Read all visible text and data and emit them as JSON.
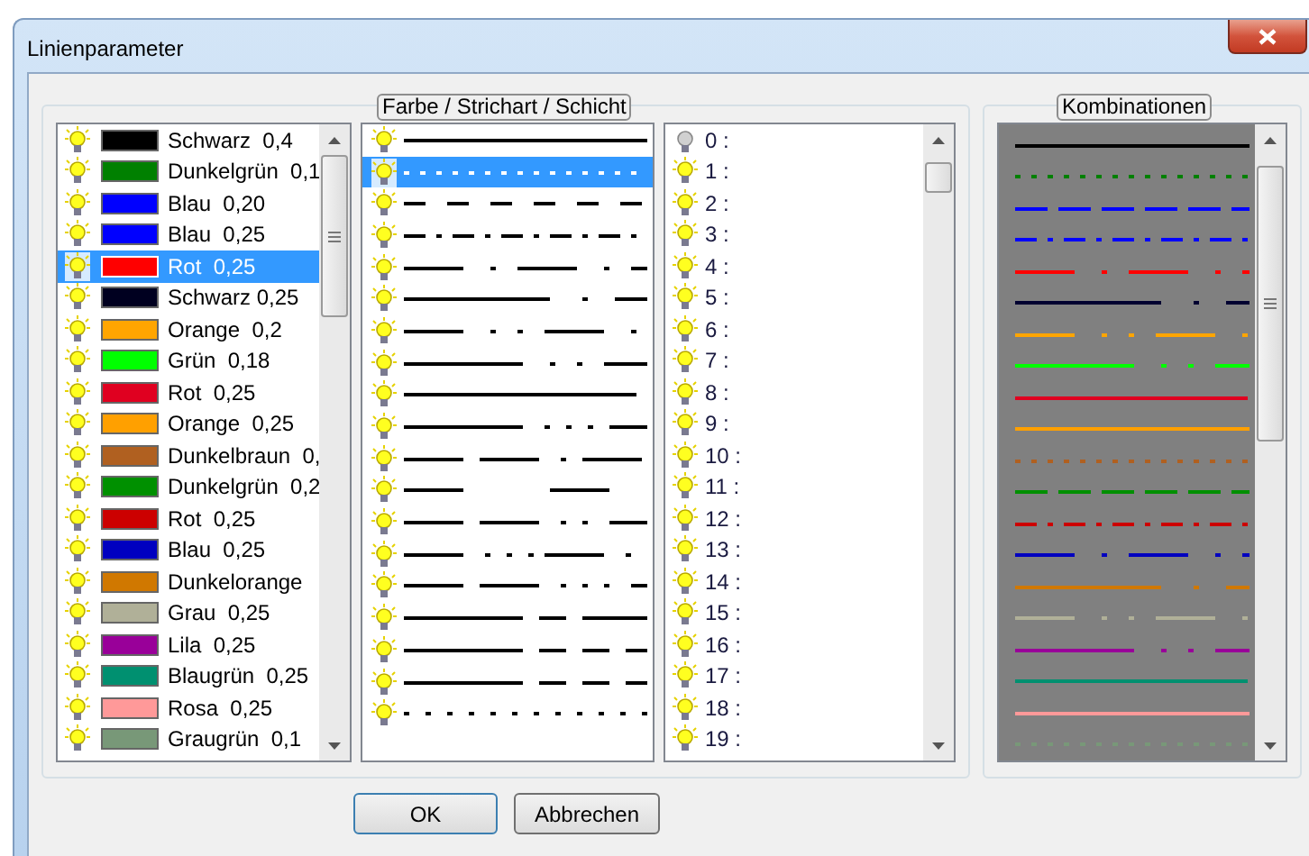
{
  "window": {
    "title": "Linienparameter"
  },
  "groups": [
    {
      "title": "Farbe / Strichart / Schicht"
    },
    {
      "title": "Kombinationen"
    }
  ],
  "colors": [
    {
      "label": "Schwarz  0,4",
      "color": "#000000",
      "lit": true,
      "selected": false
    },
    {
      "label": "Dunkelgrün  0,1",
      "color": "#008000",
      "lit": true,
      "selected": false
    },
    {
      "label": "Blau  0,20",
      "color": "#0000ff",
      "lit": true,
      "selected": false
    },
    {
      "label": "Blau  0,25",
      "color": "#0000ff",
      "lit": true,
      "selected": false
    },
    {
      "label": "Rot  0,25",
      "color": "#ff0000",
      "lit": true,
      "selected": true
    },
    {
      "label": "Schwarz 0,25",
      "color": "#000020",
      "lit": true,
      "selected": false
    },
    {
      "label": "Orange  0,2",
      "color": "#ffa500",
      "lit": true,
      "selected": false
    },
    {
      "label": "Grün  0,18",
      "color": "#00ff00",
      "lit": true,
      "selected": false
    },
    {
      "label": "Rot  0,25",
      "color": "#e00020",
      "lit": true,
      "selected": false
    },
    {
      "label": "Orange  0,25",
      "color": "#ffa000",
      "lit": true,
      "selected": false
    },
    {
      "label": "Dunkelbraun  0,",
      "color": "#b06020",
      "lit": true,
      "selected": false
    },
    {
      "label": "Dunkelgrün  0,2",
      "color": "#009000",
      "lit": true,
      "selected": false
    },
    {
      "label": "Rot  0,25",
      "color": "#cc0000",
      "lit": true,
      "selected": false
    },
    {
      "label": "Blau  0,25",
      "color": "#0000c0",
      "lit": true,
      "selected": false
    },
    {
      "label": "Dunkelorange",
      "color": "#d07800",
      "lit": true,
      "selected": false
    },
    {
      "label": "Grau  0,25",
      "color": "#b0b098",
      "lit": true,
      "selected": false
    },
    {
      "label": "Lila  0,25",
      "color": "#990099",
      "lit": true,
      "selected": false
    },
    {
      "label": "Blaugrün  0,25",
      "color": "#009070",
      "lit": true,
      "selected": false
    },
    {
      "label": "Rosa  0,25",
      "color": "#ff9999",
      "lit": true,
      "selected": false
    },
    {
      "label": "Graugrün  0,1",
      "color": "#789878",
      "lit": true,
      "selected": false
    }
  ],
  "line_styles": [
    {
      "kind": "solid",
      "lit": true,
      "selected": false
    },
    {
      "kind": "dotted",
      "lit": true,
      "selected": true
    },
    {
      "kind": "dashed",
      "lit": true,
      "selected": false
    },
    {
      "kind": "dashdot",
      "lit": true,
      "selected": false
    },
    {
      "kind": "longdashdot",
      "lit": true,
      "selected": false
    },
    {
      "kind": "verylongdashdot",
      "lit": true,
      "selected": false
    },
    {
      "kind": "longdashdotdot",
      "lit": true,
      "selected": false
    },
    {
      "kind": "verylongdashdotdot",
      "lit": true,
      "selected": false
    },
    {
      "kind": "longgap",
      "lit": true,
      "selected": false
    },
    {
      "kind": "verylongdashdotdotdot",
      "lit": true,
      "selected": false
    },
    {
      "kind": "dashdashdot",
      "lit": true,
      "selected": false
    },
    {
      "kind": "dashwidegap",
      "lit": true,
      "selected": false
    },
    {
      "kind": "dashdashdotdot",
      "lit": true,
      "selected": false
    },
    {
      "kind": "dashdotdotdot",
      "lit": true,
      "selected": false
    },
    {
      "kind": "dashdashdotdotdot",
      "lit": true,
      "selected": false
    },
    {
      "kind": "longdashshort",
      "lit": true,
      "selected": false
    },
    {
      "kind": "longdashshortshort",
      "lit": true,
      "selected": false
    },
    {
      "kind": "longdashshortshort",
      "lit": true,
      "selected": false
    },
    {
      "kind": "sparsedotted",
      "lit": true,
      "selected": false
    }
  ],
  "layers": [
    {
      "label": "0 :",
      "lit": false,
      "selected": false
    },
    {
      "label": "1 :",
      "lit": true,
      "selected": false
    },
    {
      "label": "2 :",
      "lit": true,
      "selected": false
    },
    {
      "label": "3 :",
      "lit": true,
      "selected": false
    },
    {
      "label": "4 :",
      "lit": true,
      "selected": false
    },
    {
      "label": "5 :",
      "lit": true,
      "selected": false
    },
    {
      "label": "6 :",
      "lit": true,
      "selected": false
    },
    {
      "label": "7 :",
      "lit": true,
      "selected": false
    },
    {
      "label": "8 :",
      "lit": true,
      "selected": false
    },
    {
      "label": "9 :",
      "lit": true,
      "selected": false
    },
    {
      "label": "10 :",
      "lit": true,
      "selected": false
    },
    {
      "label": "11 :",
      "lit": true,
      "selected": false
    },
    {
      "label": "12 :",
      "lit": true,
      "selected": false
    },
    {
      "label": "13 :",
      "lit": true,
      "selected": false
    },
    {
      "label": "14 :",
      "lit": true,
      "selected": false
    },
    {
      "label": "15 :",
      "lit": true,
      "selected": false
    },
    {
      "label": "16 :",
      "lit": true,
      "selected": false
    },
    {
      "label": "17 :",
      "lit": true,
      "selected": false
    },
    {
      "label": "18 :",
      "lit": true,
      "selected": false
    },
    {
      "label": "19 :",
      "lit": true,
      "selected": false
    }
  ],
  "combinations": [
    {
      "color": "#000000",
      "kind": "solid"
    },
    {
      "color": "#008000",
      "kind": "dotted"
    },
    {
      "color": "#0000ff",
      "kind": "widedashed"
    },
    {
      "color": "#0000ff",
      "kind": "dashdot"
    },
    {
      "color": "#ff0000",
      "kind": "longdashdot"
    },
    {
      "color": "#000030",
      "kind": "verylongdashdot"
    },
    {
      "color": "#ffa500",
      "kind": "longdashdotdot"
    },
    {
      "color": "#00ff00",
      "kind": "verylongdashdotdot"
    },
    {
      "color": "#e00020",
      "kind": "longgap"
    },
    {
      "color": "#ffa000",
      "kind": "solid"
    },
    {
      "color": "#b06020",
      "kind": "dotted"
    },
    {
      "color": "#009000",
      "kind": "widedashed"
    },
    {
      "color": "#cc0000",
      "kind": "dashdot"
    },
    {
      "color": "#0000c0",
      "kind": "longdashdot"
    },
    {
      "color": "#d07800",
      "kind": "verylongdashdot"
    },
    {
      "color": "#b0b098",
      "kind": "longdashdotdot"
    },
    {
      "color": "#990099",
      "kind": "verylongdashdotdot"
    },
    {
      "color": "#009070",
      "kind": "longgap"
    },
    {
      "color": "#ff9999",
      "kind": "solid"
    },
    {
      "color": "#789878",
      "kind": "dotted"
    }
  ],
  "buttons": [
    {
      "label": "OK"
    },
    {
      "label": "Abbrechen"
    }
  ]
}
